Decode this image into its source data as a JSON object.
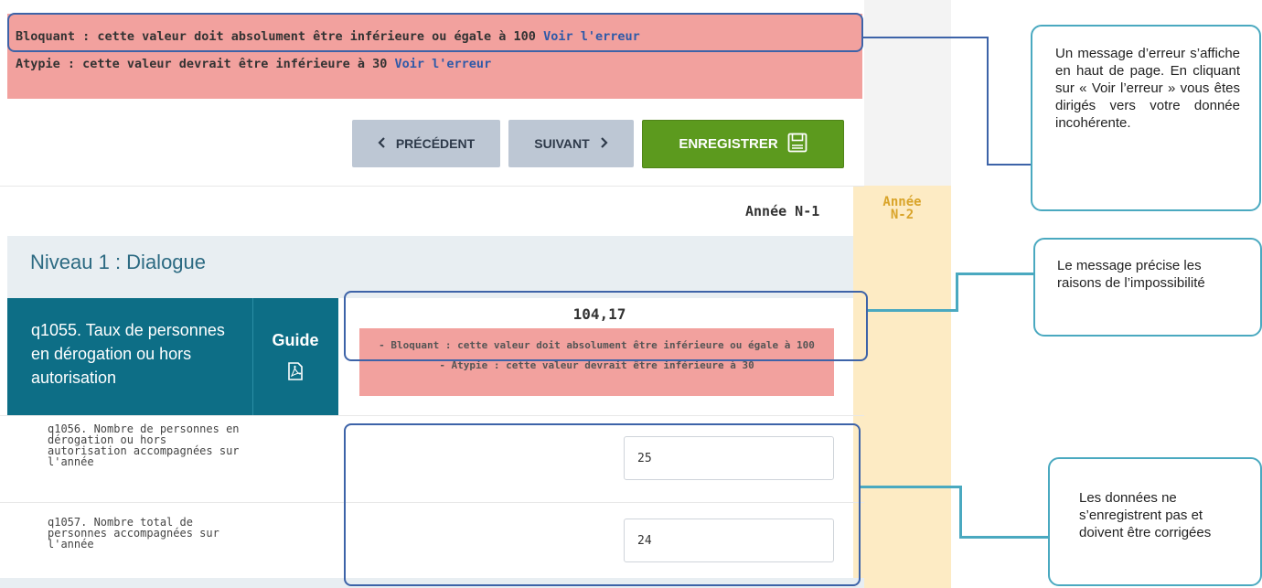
{
  "alerts_top": {
    "line1_text": "Bloquant : cette valeur doit absolument être inférieure ou égale à 100",
    "line1_link": "Voir l'erreur",
    "line2_text": "Atypie : cette valeur devrait être inférieure à 30",
    "line2_link": "Voir l'erreur"
  },
  "nav": {
    "prev_label": "PRÉCÉDENT",
    "prev_icon": "chevron-left-icon",
    "next_label": "SUIVANT",
    "next_icon": "chevron-right-icon",
    "save_label": "ENREGISTRER",
    "save_icon": "floppy-disk-icon"
  },
  "columns": {
    "year_n1": "Année N-1",
    "year_n2_line1": "Année",
    "year_n2_line2": "N-2"
  },
  "section": {
    "title": "Niveau 1 : Dialogue"
  },
  "question": {
    "title": "q1055. Taux de personnes en dérogation ou hors autorisation",
    "guide_label": "Guide",
    "guide_icon": "pdf-icon",
    "value": "104,17",
    "error_bloquant": "- Bloquant : cette valeur doit absolument être inférieure ou égale à 100",
    "error_atypie": "- Atypie : cette valeur devrait être inférieure à 30"
  },
  "subquestions": [
    {
      "label": "q1056. Nombre de personnes en dérogation ou hors autorisation accompagnées sur l'année",
      "value": "25"
    },
    {
      "label": "q1057. Nombre total de personnes accompagnées sur l'année",
      "value": "24"
    }
  ],
  "callouts": {
    "error_message": "Un message d’erreur s’affiche en haut de page. En cliquant sur « Voir l’erreur » vous êtes dirigés vers votre donnée incohérente.",
    "reasons": "Le message précise les raisons de l’impossibilité",
    "not_saved": "Les données ne s’enregistrent pas et doivent être corrigées"
  },
  "colors": {
    "alert_bg": "#f2a19e",
    "link": "#2f5aa8",
    "save_green": "#5c9a1e",
    "header_teal": "#0d6e86",
    "callout_border": "#4aa9c0",
    "outline_blue": "#3d63a8",
    "n2_column": "#fdebc4"
  }
}
